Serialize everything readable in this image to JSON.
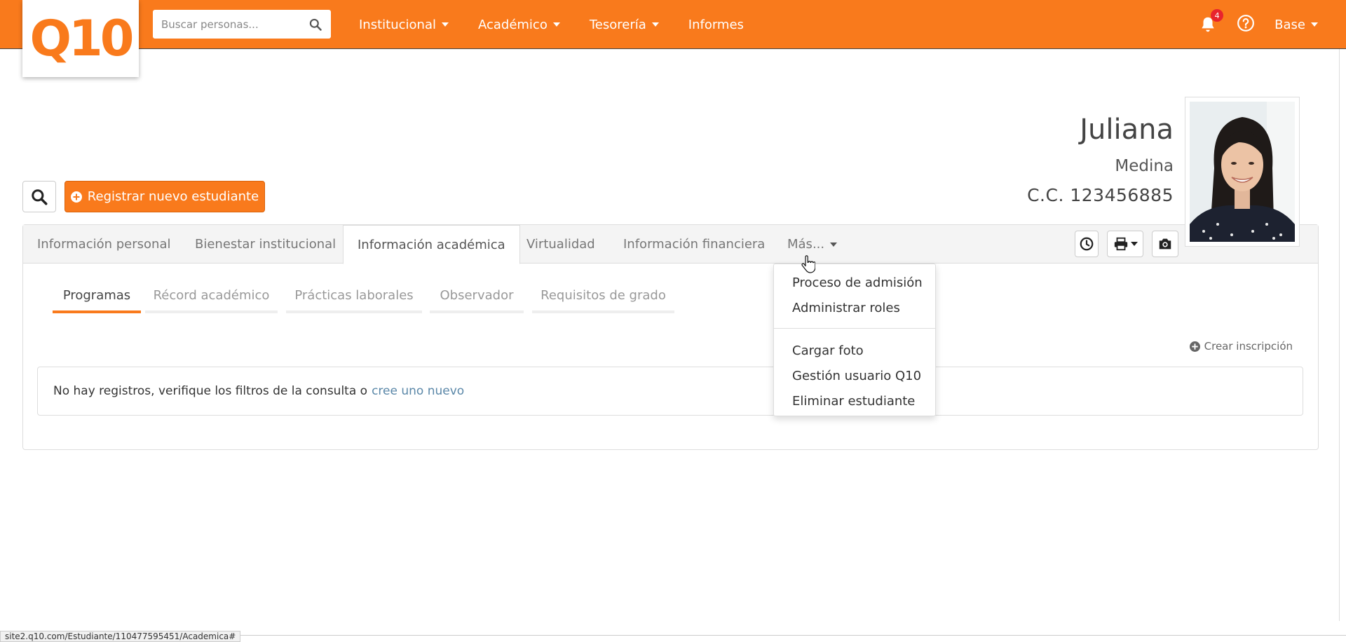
{
  "brand": {
    "logo": "Q10",
    "accent": "#f97a1c"
  },
  "search": {
    "placeholder": "Buscar personas..."
  },
  "nav": {
    "items": [
      {
        "label": "Institucional",
        "has_caret": true
      },
      {
        "label": "Académico",
        "has_caret": true
      },
      {
        "label": "Tesorería",
        "has_caret": true
      },
      {
        "label": "Informes",
        "has_caret": false
      }
    ]
  },
  "notifications": {
    "count": "4"
  },
  "user_menu": {
    "label": "Base"
  },
  "student": {
    "first_name": "Juliana",
    "last_name": "Medina",
    "id_label": "C.C. 123456885"
  },
  "actions": {
    "register_label": "Registrar nuevo estudiante"
  },
  "tabs": [
    {
      "label": "Información personal"
    },
    {
      "label": "Bienestar institucional"
    },
    {
      "label": "Información académica"
    },
    {
      "label": "Virtualidad"
    },
    {
      "label": "Información financiera"
    },
    {
      "label": "Más..."
    }
  ],
  "subtabs": [
    {
      "label": "Programas"
    },
    {
      "label": "Récord académico"
    },
    {
      "label": "Prácticas laborales"
    },
    {
      "label": "Observador"
    },
    {
      "label": "Requisitos de grado"
    }
  ],
  "create_link": {
    "label": "Crear inscripción"
  },
  "empty_state": {
    "message": "No hay registros, verifique los filtros de la consulta o",
    "link": "cree uno nuevo"
  },
  "dropdown": {
    "group1": [
      {
        "label": "Proceso de admisión"
      },
      {
        "label": "Administrar roles"
      }
    ],
    "group2": [
      {
        "label": "Cargar foto"
      },
      {
        "label": "Gestión usuario Q10"
      },
      {
        "label": "Eliminar estudiante"
      }
    ]
  },
  "status_bar": {
    "url": "site2.q10.com/Estudiante/110477595451/Academica#"
  }
}
